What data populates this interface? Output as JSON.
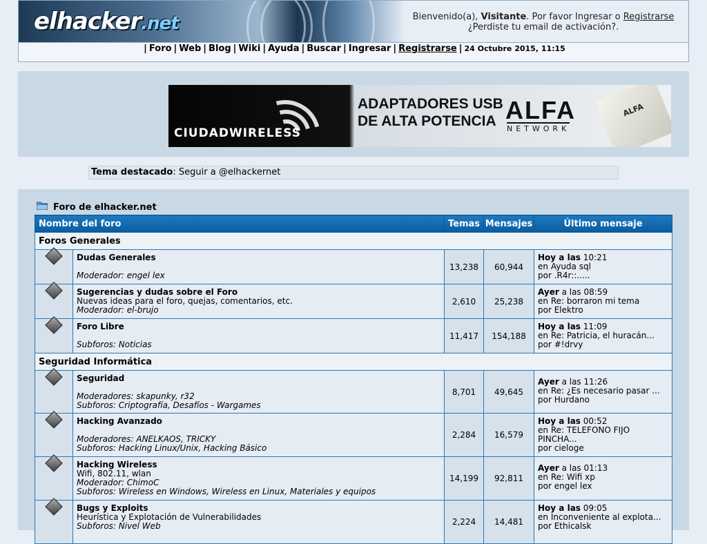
{
  "header": {
    "logo_text": "elhacker",
    "logo_suffix": ".net",
    "welcome_prefix": "Bienvenido(a), ",
    "welcome_user": "Visitante",
    "welcome_mid": ". Por favor Ingresar o ",
    "welcome_register": "Registrarse",
    "welcome_line2": "¿Perdiste tu email de activación?."
  },
  "nav": {
    "items": [
      "Foro",
      "Web",
      "Blog",
      "Wiki",
      "Ayuda",
      "Buscar",
      "Ingresar",
      "Registrarse"
    ],
    "date": "24 Octubre 2015, 11:15"
  },
  "banner": {
    "brand": "CIUDADWIRELESS",
    "line1": "ADAPTADORES USB",
    "line2": "DE ALTA POTENCIA",
    "alfa": "ALFA",
    "network": "NETWORK",
    "device_label": "ALFA"
  },
  "featured": {
    "label": "Tema destacado",
    "text": ": Seguir a @elhackernet"
  },
  "forum": {
    "title": "Foro de elhacker.net",
    "columns": [
      "Nombre del foro",
      "Temas",
      "Mensajes",
      "Último mensaje"
    ],
    "categories": [
      {
        "name": "Foros Generales",
        "boards": [
          {
            "name": "Dudas Generales",
            "desc": "",
            "mods": "Moderador: engel lex",
            "subs": "",
            "topics": "13,238",
            "posts": "60,944",
            "last_when_b": "Hoy a las",
            "last_when": " 10:21",
            "last_in": "en Ayuda sql",
            "last_by": "por .R4r::....."
          },
          {
            "name": "Sugerencias y dudas sobre el Foro",
            "desc": "Nuevas ideas para el foro, quejas, comentarios, etc.",
            "mods": "Moderador: el-brujo",
            "subs": "",
            "topics": "2,610",
            "posts": "25,238",
            "last_when_b": "Ayer",
            "last_when": " a las 08:59",
            "last_in": "en Re: borraron mi tema",
            "last_by": "por Elektro"
          },
          {
            "name": "Foro Libre",
            "desc": "",
            "mods": "",
            "subs": "Subforos: Noticias",
            "topics": "11,417",
            "posts": "154,188",
            "last_when_b": "Hoy a las",
            "last_when": " 11:09",
            "last_in": "en Re: Patricia, el huracán...",
            "last_by": "por #!drvy"
          }
        ]
      },
      {
        "name": "Seguridad Informática",
        "boards": [
          {
            "name": "Seguridad",
            "desc": "",
            "mods": "Moderadores: skapunky, r32",
            "subs": "Subforos: Criptografía, Desafíos - Wargames",
            "topics": "8,701",
            "posts": "49,645",
            "last_when_b": "Ayer",
            "last_when": " a las 11:26",
            "last_in": "en Re: ¿Es necesario pasar ...",
            "last_by": "por Hurdano"
          },
          {
            "name": "Hacking Avanzado",
            "desc": "",
            "mods": "Moderadores: ANELKAOS, TRICKY",
            "subs": "Subforos: Hacking Linux/Unix, Hacking Básico",
            "topics": "2,284",
            "posts": "16,579",
            "last_when_b": "Hoy a las",
            "last_when": " 00:52",
            "last_in": "en Re: TELEFONO FIJO PINCHA...",
            "last_by": "por cieloge"
          },
          {
            "name": "Hacking Wireless",
            "desc": "Wifi, 802.11, wlan",
            "mods": "Moderador: ChimoC",
            "subs": "Subforos: Wireless en Windows, Wireless en Linux, Materiales y equipos",
            "topics": "14,199",
            "posts": "92,811",
            "last_when_b": "Ayer",
            "last_when": " a las 01:13",
            "last_in": "en Re: Wifi xp",
            "last_by": "por engel lex"
          },
          {
            "name": "Bugs y Exploits",
            "desc": "Heurística y Explotación de Vulnerabilidades",
            "mods": "",
            "subs": "Subforos: Nivel Web",
            "topics": "2,224",
            "posts": "14,481",
            "last_when_b": "Hoy a las",
            "last_when": " 09:05",
            "last_in": "en Inconveniente al explota...",
            "last_by": "por Ethicalsk"
          }
        ]
      }
    ]
  }
}
